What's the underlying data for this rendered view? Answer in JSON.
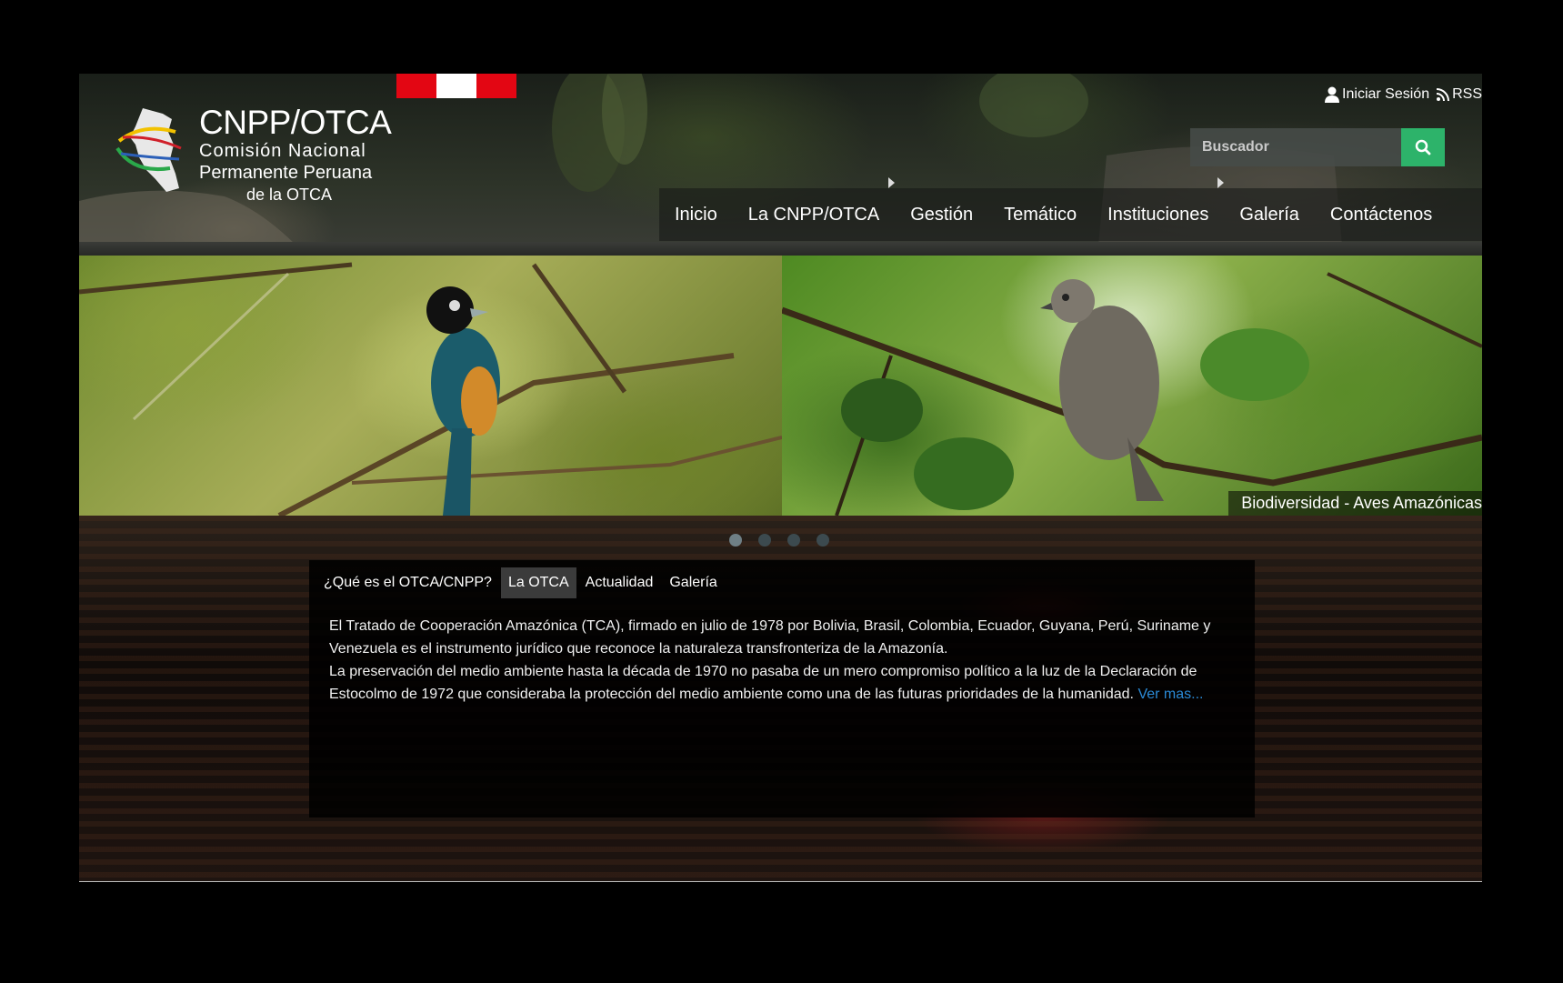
{
  "header": {
    "logo": {
      "title": "CNPP/OTCA",
      "line1": "Comisión  Nacional",
      "line2": "Permanente Peruana",
      "line3": "de la OTCA"
    },
    "topbar": {
      "login_label": "Iniciar Sesión",
      "rss_label": "RSS"
    },
    "search": {
      "placeholder": "Buscador"
    },
    "nav": [
      {
        "label": "Inicio"
      },
      {
        "label": "La CNPP/OTCA"
      },
      {
        "label": "Gestión"
      },
      {
        "label": "Temático"
      },
      {
        "label": "Instituciones"
      },
      {
        "label": "Galería"
      },
      {
        "label": "Contáctenos"
      }
    ]
  },
  "slider": {
    "caption": "Biodiversidad - Aves Amazónicas",
    "active_dot": 0
  },
  "panel": {
    "tabs": [
      {
        "label": "¿Qué es el OTCA/CNPP?"
      },
      {
        "label": "La OTCA"
      },
      {
        "label": "Actualidad"
      },
      {
        "label": "Galería"
      }
    ],
    "active_tab": 1,
    "paragraph1": "El Tratado de Cooperación Amazónica (TCA), firmado en julio de 1978 por Bolivia, Brasil, Colombia, Ecuador, Guyana, Perú, Suriname y Venezuela es el instrumento jurídico que reconoce la naturaleza transfronteriza de la Amazonía.",
    "paragraph2": "La preservación del medio ambiente hasta la década de 1970 no pasaba de un mero compromiso político a la luz de la Declaración de Estocolmo de 1972 que consideraba la protección del medio ambiente como una de las futuras prioridades de la humanidad.",
    "more_link": "Ver mas..."
  },
  "colors": {
    "search_button": "#2db36a",
    "link": "#2b8ad6",
    "flag_red": "#e30613"
  }
}
